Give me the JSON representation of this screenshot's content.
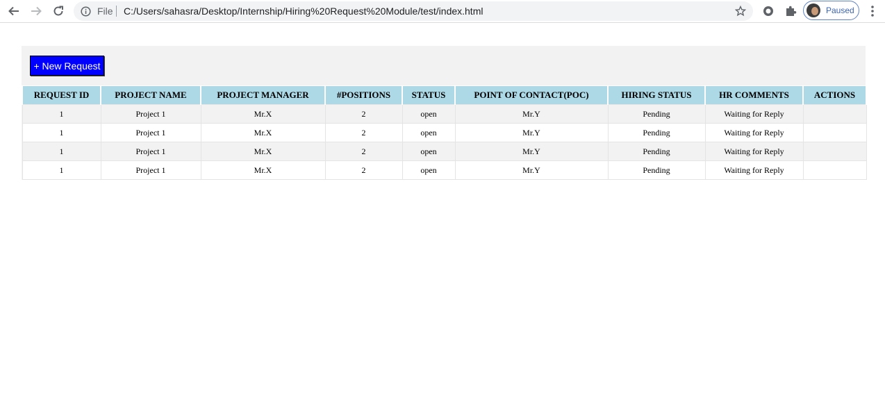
{
  "browser": {
    "file_label": "File",
    "url": "C:/Users/sahasra/Desktop/Internship/Hiring%20Request%20Module/test/index.html",
    "profile_label": "Paused"
  },
  "page": {
    "new_request_label": "+ New Request",
    "columns": [
      "REQUEST ID",
      "PROJECT NAME",
      "PROJECT MANAGER",
      "#POSITIONS",
      "STATUS",
      "POINT OF CONTACT(POC)",
      "HIRING STATUS",
      "HR COMMENTS",
      "ACTIONS"
    ],
    "rows": [
      [
        "1",
        "Project 1",
        "Mr.X",
        "2",
        "open",
        "Mr.Y",
        "Pending",
        "Waiting for Reply",
        ""
      ],
      [
        "1",
        "Project 1",
        "Mr.X",
        "2",
        "open",
        "Mr.Y",
        "Pending",
        "Waiting for Reply",
        ""
      ],
      [
        "1",
        "Project 1",
        "Mr.X",
        "2",
        "open",
        "Mr.Y",
        "Pending",
        "Waiting for Reply",
        ""
      ],
      [
        "1",
        "Project 1",
        "Mr.X",
        "2",
        "open",
        "Mr.Y",
        "Pending",
        "Waiting for Reply",
        ""
      ]
    ]
  },
  "colors": {
    "button_bg": "#0000ff",
    "header_bg": "#add8e6",
    "stripe_bg": "#f2f2f2"
  },
  "icons": [
    "back-arrow-icon",
    "forward-arrow-icon",
    "reload-icon",
    "info-icon",
    "star-icon",
    "extension-circle-icon",
    "puzzle-icon",
    "three-dots-menu-icon"
  ]
}
